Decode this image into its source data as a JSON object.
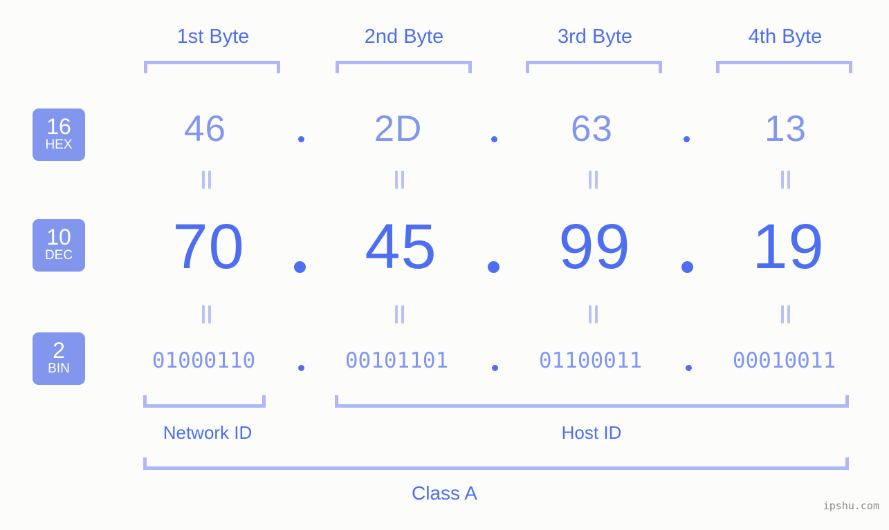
{
  "background_color": "#fcfdfa",
  "accent_colors": {
    "strong_blue": "#4e6ef0",
    "light_blue": "#8296ee",
    "bracket_blue": "#aeb8f7",
    "badge_fill": "#8296ee",
    "badge_text": "#ffffff",
    "watermark_gray": "#8a8a8a"
  },
  "byte_headers": [
    {
      "label": "1st Byte"
    },
    {
      "label": "2nd Byte"
    },
    {
      "label": "3rd Byte"
    },
    {
      "label": "4th Byte"
    }
  ],
  "bases": [
    {
      "number": "16",
      "name": "HEX"
    },
    {
      "number": "10",
      "name": "DEC"
    },
    {
      "number": "2",
      "name": "BIN"
    }
  ],
  "separator": ".",
  "equals_mark": "||",
  "rows": {
    "hex": {
      "base_number": "16",
      "base_name": "HEX",
      "values": [
        "46",
        "2D",
        "63",
        "13"
      ]
    },
    "dec": {
      "base_number": "10",
      "base_name": "DEC",
      "values": [
        "70",
        "45",
        "99",
        "19"
      ]
    },
    "bin": {
      "base_number": "2",
      "base_name": "BIN",
      "values": [
        "01000110",
        "00101101",
        "01100011",
        "00010011"
      ]
    }
  },
  "id_sections": [
    {
      "label": "Network ID"
    },
    {
      "label": "Host ID"
    }
  ],
  "class": {
    "label": "Class A"
  },
  "watermark": {
    "text": "ipshu.com"
  }
}
